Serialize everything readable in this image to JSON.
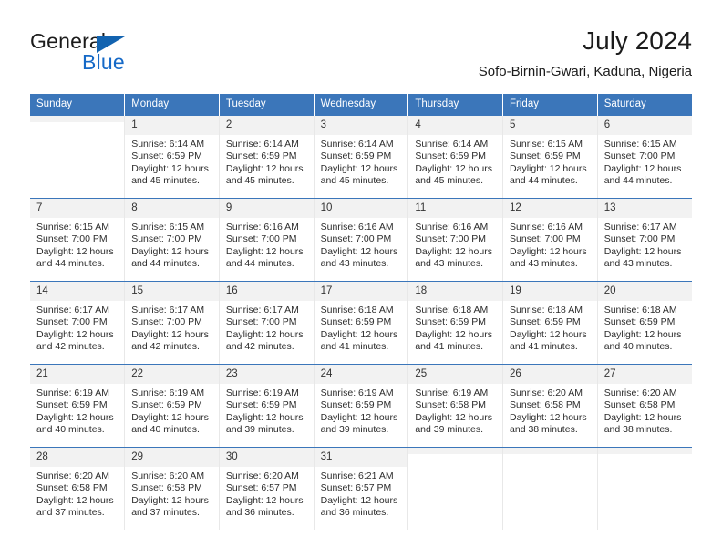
{
  "brand": {
    "name_part1": "General",
    "name_part2": "Blue",
    "triangle_color": "#1263b0",
    "blue_color": "#1569c7"
  },
  "header": {
    "title": "July 2024",
    "subtitle": "Sofo-Birnin-Gwari, Kaduna, Nigeria"
  },
  "theme": {
    "header_bg": "#3b76ba",
    "daynum_bg": "#f2f2f2",
    "row_separator": "#3b76ba",
    "col_separator": "#e8e8e8"
  },
  "weekdays": [
    "Sunday",
    "Monday",
    "Tuesday",
    "Wednesday",
    "Thursday",
    "Friday",
    "Saturday"
  ],
  "weeks": [
    [
      {
        "day": "",
        "sunrise": "",
        "sunset": "",
        "daylight": "",
        "empty": true
      },
      {
        "day": "1",
        "sunrise": "Sunrise: 6:14 AM",
        "sunset": "Sunset: 6:59 PM",
        "daylight": "Daylight: 12 hours and 45 minutes."
      },
      {
        "day": "2",
        "sunrise": "Sunrise: 6:14 AM",
        "sunset": "Sunset: 6:59 PM",
        "daylight": "Daylight: 12 hours and 45 minutes."
      },
      {
        "day": "3",
        "sunrise": "Sunrise: 6:14 AM",
        "sunset": "Sunset: 6:59 PM",
        "daylight": "Daylight: 12 hours and 45 minutes."
      },
      {
        "day": "4",
        "sunrise": "Sunrise: 6:14 AM",
        "sunset": "Sunset: 6:59 PM",
        "daylight": "Daylight: 12 hours and 45 minutes."
      },
      {
        "day": "5",
        "sunrise": "Sunrise: 6:15 AM",
        "sunset": "Sunset: 6:59 PM",
        "daylight": "Daylight: 12 hours and 44 minutes."
      },
      {
        "day": "6",
        "sunrise": "Sunrise: 6:15 AM",
        "sunset": "Sunset: 7:00 PM",
        "daylight": "Daylight: 12 hours and 44 minutes."
      }
    ],
    [
      {
        "day": "7",
        "sunrise": "Sunrise: 6:15 AM",
        "sunset": "Sunset: 7:00 PM",
        "daylight": "Daylight: 12 hours and 44 minutes."
      },
      {
        "day": "8",
        "sunrise": "Sunrise: 6:15 AM",
        "sunset": "Sunset: 7:00 PM",
        "daylight": "Daylight: 12 hours and 44 minutes."
      },
      {
        "day": "9",
        "sunrise": "Sunrise: 6:16 AM",
        "sunset": "Sunset: 7:00 PM",
        "daylight": "Daylight: 12 hours and 44 minutes."
      },
      {
        "day": "10",
        "sunrise": "Sunrise: 6:16 AM",
        "sunset": "Sunset: 7:00 PM",
        "daylight": "Daylight: 12 hours and 43 minutes."
      },
      {
        "day": "11",
        "sunrise": "Sunrise: 6:16 AM",
        "sunset": "Sunset: 7:00 PM",
        "daylight": "Daylight: 12 hours and 43 minutes."
      },
      {
        "day": "12",
        "sunrise": "Sunrise: 6:16 AM",
        "sunset": "Sunset: 7:00 PM",
        "daylight": "Daylight: 12 hours and 43 minutes."
      },
      {
        "day": "13",
        "sunrise": "Sunrise: 6:17 AM",
        "sunset": "Sunset: 7:00 PM",
        "daylight": "Daylight: 12 hours and 43 minutes."
      }
    ],
    [
      {
        "day": "14",
        "sunrise": "Sunrise: 6:17 AM",
        "sunset": "Sunset: 7:00 PM",
        "daylight": "Daylight: 12 hours and 42 minutes."
      },
      {
        "day": "15",
        "sunrise": "Sunrise: 6:17 AM",
        "sunset": "Sunset: 7:00 PM",
        "daylight": "Daylight: 12 hours and 42 minutes."
      },
      {
        "day": "16",
        "sunrise": "Sunrise: 6:17 AM",
        "sunset": "Sunset: 7:00 PM",
        "daylight": "Daylight: 12 hours and 42 minutes."
      },
      {
        "day": "17",
        "sunrise": "Sunrise: 6:18 AM",
        "sunset": "Sunset: 6:59 PM",
        "daylight": "Daylight: 12 hours and 41 minutes."
      },
      {
        "day": "18",
        "sunrise": "Sunrise: 6:18 AM",
        "sunset": "Sunset: 6:59 PM",
        "daylight": "Daylight: 12 hours and 41 minutes."
      },
      {
        "day": "19",
        "sunrise": "Sunrise: 6:18 AM",
        "sunset": "Sunset: 6:59 PM",
        "daylight": "Daylight: 12 hours and 41 minutes."
      },
      {
        "day": "20",
        "sunrise": "Sunrise: 6:18 AM",
        "sunset": "Sunset: 6:59 PM",
        "daylight": "Daylight: 12 hours and 40 minutes."
      }
    ],
    [
      {
        "day": "21",
        "sunrise": "Sunrise: 6:19 AM",
        "sunset": "Sunset: 6:59 PM",
        "daylight": "Daylight: 12 hours and 40 minutes."
      },
      {
        "day": "22",
        "sunrise": "Sunrise: 6:19 AM",
        "sunset": "Sunset: 6:59 PM",
        "daylight": "Daylight: 12 hours and 40 minutes."
      },
      {
        "day": "23",
        "sunrise": "Sunrise: 6:19 AM",
        "sunset": "Sunset: 6:59 PM",
        "daylight": "Daylight: 12 hours and 39 minutes."
      },
      {
        "day": "24",
        "sunrise": "Sunrise: 6:19 AM",
        "sunset": "Sunset: 6:59 PM",
        "daylight": "Daylight: 12 hours and 39 minutes."
      },
      {
        "day": "25",
        "sunrise": "Sunrise: 6:19 AM",
        "sunset": "Sunset: 6:58 PM",
        "daylight": "Daylight: 12 hours and 39 minutes."
      },
      {
        "day": "26",
        "sunrise": "Sunrise: 6:20 AM",
        "sunset": "Sunset: 6:58 PM",
        "daylight": "Daylight: 12 hours and 38 minutes."
      },
      {
        "day": "27",
        "sunrise": "Sunrise: 6:20 AM",
        "sunset": "Sunset: 6:58 PM",
        "daylight": "Daylight: 12 hours and 38 minutes."
      }
    ],
    [
      {
        "day": "28",
        "sunrise": "Sunrise: 6:20 AM",
        "sunset": "Sunset: 6:58 PM",
        "daylight": "Daylight: 12 hours and 37 minutes."
      },
      {
        "day": "29",
        "sunrise": "Sunrise: 6:20 AM",
        "sunset": "Sunset: 6:58 PM",
        "daylight": "Daylight: 12 hours and 37 minutes."
      },
      {
        "day": "30",
        "sunrise": "Sunrise: 6:20 AM",
        "sunset": "Sunset: 6:57 PM",
        "daylight": "Daylight: 12 hours and 36 minutes."
      },
      {
        "day": "31",
        "sunrise": "Sunrise: 6:21 AM",
        "sunset": "Sunset: 6:57 PM",
        "daylight": "Daylight: 12 hours and 36 minutes."
      },
      {
        "day": "",
        "sunrise": "",
        "sunset": "",
        "daylight": "",
        "empty": true
      },
      {
        "day": "",
        "sunrise": "",
        "sunset": "",
        "daylight": "",
        "empty": true
      },
      {
        "day": "",
        "sunrise": "",
        "sunset": "",
        "daylight": "",
        "empty": true
      }
    ]
  ]
}
